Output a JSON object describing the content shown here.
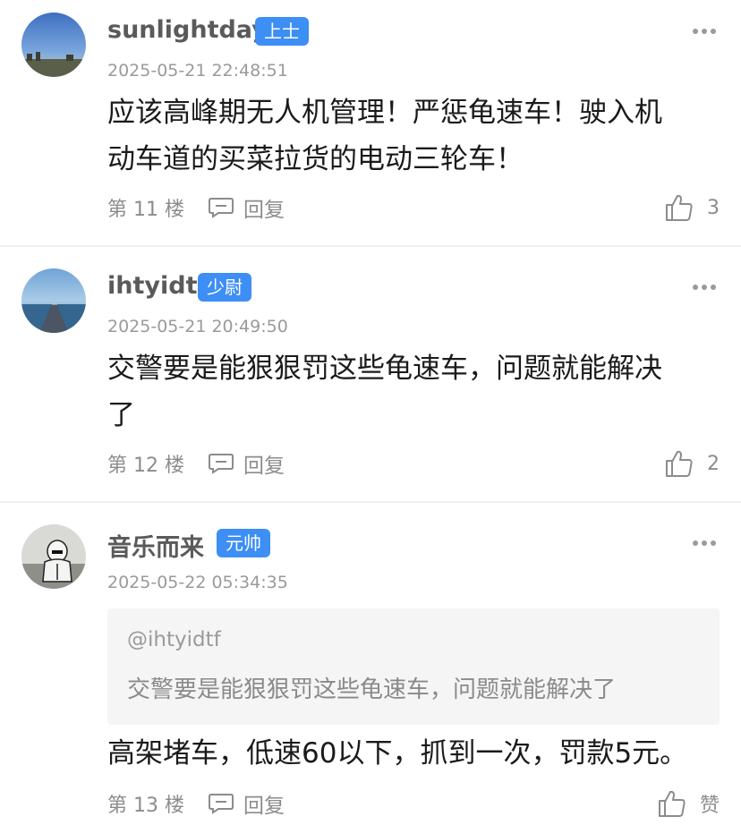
{
  "comments": [
    {
      "username": "sunlightday",
      "badge": "上士",
      "time": "2025-05-21 22:48:51",
      "body_line1": "应该高峰期无人机管理！严惩龟速车！驶入机",
      "body_line2": "动车道的买菜拉货的电动三轮车！",
      "floor": "第 11 楼",
      "reply_label": "回复",
      "like_count": "3"
    },
    {
      "username": "ihtyidtf",
      "badge": "少尉",
      "time": "2025-05-21 20:49:50",
      "body_line1": "交警要是能狠狠罚这些龟速车，问题就能解决",
      "body_line2": "了",
      "floor": "第 12 楼",
      "reply_label": "回复",
      "like_count": "2"
    },
    {
      "username": "音乐而来",
      "badge": "元帅",
      "time": "2025-05-22 05:34:35",
      "quote_user": "@ihtyidtf",
      "quote_text": "交警要是能狠狠罚这些龟速车，问题就能解决了",
      "body_line1": "高架堵车，低速60以下，抓到一次，罚款5元。",
      "floor": "第 13 楼",
      "reply_label": "回复",
      "like_count": "赞"
    }
  ],
  "colors": {
    "badge": "#3d8ef5",
    "meta_text": "#9a9a9a",
    "quote_bg": "#f5f5f5"
  },
  "icons": {
    "more": "more-dots-icon",
    "reply": "comment-bubble-icon",
    "like": "thumbs-up-icon"
  }
}
